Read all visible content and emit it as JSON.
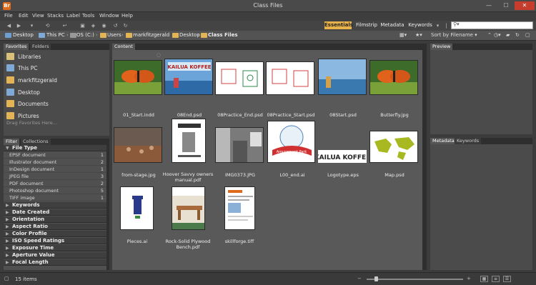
{
  "window": {
    "title": "Class Files",
    "app_icon": "Br",
    "min": "—",
    "max": "☐",
    "close": "✕"
  },
  "menu": [
    "File",
    "Edit",
    "View",
    "Stacks",
    "Label",
    "Tools",
    "Window",
    "Help"
  ],
  "workspaces": {
    "essentials": "Essentials",
    "filmstrip": "Filmstrip",
    "metadata": "Metadata",
    "keywords": "Keywords",
    "accent": "#e8b24a"
  },
  "search": {
    "icon": "⚲▾",
    "value": ""
  },
  "breadcrumb": [
    {
      "label": "Desktop",
      "icon": "desktop-icon"
    },
    {
      "label": "This PC",
      "icon": "pc-icon"
    },
    {
      "label": "OS (C:)",
      "icon": "drive-icon"
    },
    {
      "label": "Users",
      "icon": "folder-icon"
    },
    {
      "label": "markfitzgerald",
      "icon": "folder-icon"
    },
    {
      "label": "Desktop",
      "icon": "folder-icon"
    },
    {
      "label": "Class Files",
      "icon": "folder-icon"
    }
  ],
  "sort": {
    "label": "Sort by Filename"
  },
  "tabs": {
    "favorites": "Favorites",
    "folders": "Folders",
    "filter": "Filter",
    "collections": "Collections",
    "content": "Content",
    "preview": "Preview",
    "metadata": "Metadata",
    "keywords": "Keywords"
  },
  "favorites": [
    "Libraries",
    "This PC",
    "markfitzgerald",
    "Desktop",
    "Documents",
    "Pictures"
  ],
  "favorites_hint": "Drag Favorites Here...",
  "filter": {
    "file_type_label": "File Type",
    "file_types": [
      {
        "label": "EPSF document",
        "count": "1"
      },
      {
        "label": "Illustrator document",
        "count": "2"
      },
      {
        "label": "InDesign document",
        "count": "1"
      },
      {
        "label": "JPEG file",
        "count": "3"
      },
      {
        "label": "PDF document",
        "count": "2"
      },
      {
        "label": "Photoshop document",
        "count": "5"
      },
      {
        "label": "TIFF image",
        "count": "1"
      }
    ],
    "collapsed": [
      "Keywords",
      "Date Created",
      "Orientation",
      "Aspect Ratio",
      "Color Profile",
      "ISO Speed Ratings",
      "Exposure Time",
      "Aperture Value",
      "Focal Length"
    ]
  },
  "files": [
    {
      "name": "01_Start.indd",
      "thumb": "butterfly"
    },
    {
      "name": "08End.psd",
      "thumb": "kailua-ad"
    },
    {
      "name": "08Practice_End.psd",
      "thumb": "diagram"
    },
    {
      "name": "08Practice_Start.psd",
      "thumb": "diagram"
    },
    {
      "name": "08Start.psd",
      "thumb": "ocean"
    },
    {
      "name": "Butterfly.jpg",
      "thumb": "butterfly"
    },
    {
      "name": "from-stage.jpg",
      "thumb": "crowd"
    },
    {
      "name": "Hoover Savvy owners manual.pdf",
      "thumb": "manual"
    },
    {
      "name": "IMG0373.JPG",
      "thumb": "interior"
    },
    {
      "name": "L00_end.ai",
      "thumb": "amusement"
    },
    {
      "name": "Logotype.eps",
      "thumb": "logotype"
    },
    {
      "name": "Map.psd",
      "thumb": "map"
    },
    {
      "name": "Pieces.ai",
      "thumb": "tower"
    },
    {
      "name": "Rock-Solid Plywood Bench.pdf",
      "thumb": "bench"
    },
    {
      "name": "skillforge.tiff",
      "thumb": "web"
    }
  ],
  "thumb_text": {
    "kailua": "KAILUA KOFFEE",
    "amusement": "Amusement Park"
  },
  "status": {
    "items": "15 items"
  }
}
